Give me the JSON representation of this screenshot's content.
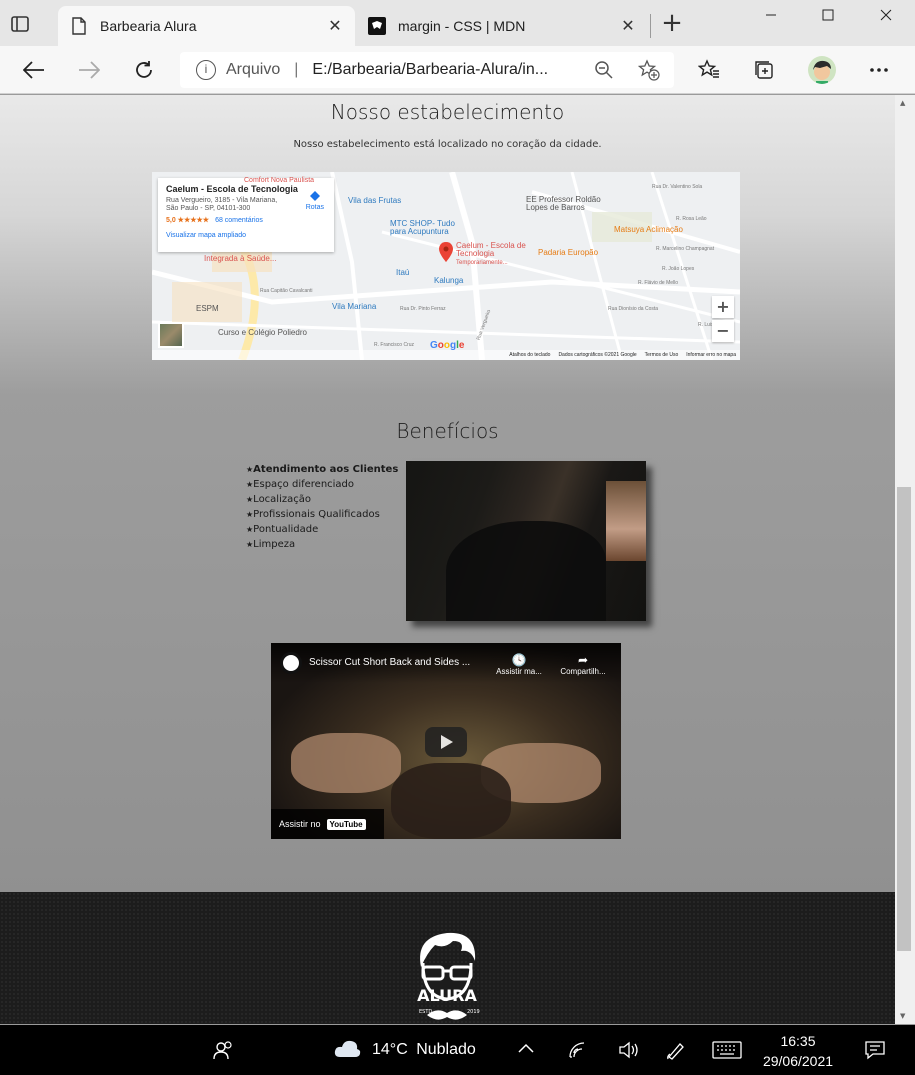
{
  "browser": {
    "tabs": [
      {
        "label": "Barbearia Alura",
        "icon": "page-icon",
        "active": true
      },
      {
        "label": "margin - CSS | MDN",
        "icon": "mdn-icon",
        "active": false
      }
    ],
    "address": {
      "security_label": "Arquivo",
      "url": "E:/Barbearia/Barbearia-Alura/in..."
    }
  },
  "page": {
    "establishment": {
      "title": "Nosso estabelecimento",
      "description": "Nosso estabelecimento está localizado no coração da cidade."
    },
    "map": {
      "card_title": "Caelum - Escola de Tecnologia",
      "card_address": "Rua Vergueiro, 3185 - Vila Mariana, São Paulo - SP, 04101-300",
      "rating": "5,0 ★★★★★",
      "reviews": "68 comentários",
      "enlarge_link": "Visualizar mapa ampliado",
      "routes": "Rotas",
      "pin_label": "Caelum - Escola de Tecnologia",
      "pin_sublabel": "Temporariamente...",
      "labels": [
        "Vila das Frutas",
        "MTC SHOP- Tudo para Acupuntura",
        "EE Professor Roldão Lopes de Barros",
        "Matsuya Aclimação",
        "Padaria Europão",
        "Kalunga",
        "Itaú",
        "Vila Mariana",
        "ESPM",
        "Curso e Colégio Poliedro",
        "Integrada à Saúde...",
        "Comfort Nova Paulista"
      ],
      "streets": [
        "Rua Dr. Valentino Sola",
        "Rua Vergueiro",
        "Rua Dr. Pinto Ferraz",
        "Rua Capitão Cavalcanti",
        "R. Francisco Cruz",
        "Rua Dionísio da Costa",
        "R. Luis Mendes",
        "R. Marcelino Champagnat",
        "R. Flávio de Mello",
        "R. Rosa Leão",
        "R. João Lopes"
      ],
      "zoom_in": "+",
      "zoom_out": "−",
      "logo": "Google",
      "footer": [
        "Atalhos do teclado",
        "Dados cartográficos ©2021 Google",
        "Termos de Uso",
        "Informar erro no mapa"
      ]
    },
    "benefits": {
      "title": "Benefícios",
      "items": [
        "Atendimento aos Clientes",
        "Espaço diferenciado",
        "Localização",
        "Profissionais Qualificados",
        "Pontualidade",
        "Limpeza"
      ]
    },
    "video": {
      "title": "Scissor Cut Short Back and Sides ...",
      "watch_later": "Assistir ma...",
      "share": "Compartilh...",
      "watch_on": "Assistir no",
      "youtube": "YouTube"
    },
    "footer_logo": {
      "name": "ALURA",
      "estd": "ESTD",
      "year": "2019"
    }
  },
  "taskbar": {
    "weather_temp": "14°C",
    "weather_desc": "Nublado",
    "time": "16:35",
    "date": "29/06/2021"
  }
}
